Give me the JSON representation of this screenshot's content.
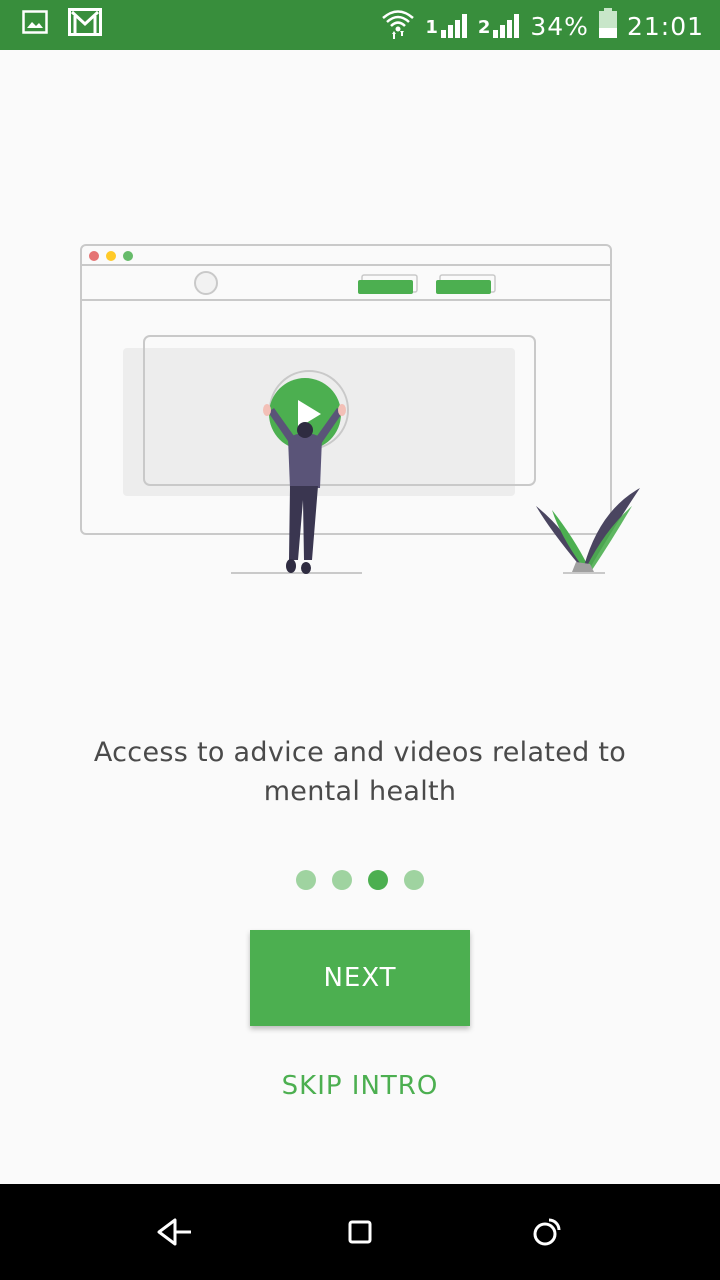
{
  "status_bar": {
    "signal_1": "1",
    "signal_2": "2",
    "battery": "34%",
    "time": "21:01",
    "icons": [
      "image-icon",
      "gmail-icon",
      "wifi-icon",
      "signal-icon",
      "battery-icon"
    ]
  },
  "onboarding": {
    "headline": "Access to advice and videos related to mental health",
    "page_indicator": {
      "total": 4,
      "current": 3
    },
    "next_label": "NEXT",
    "skip_label": "SKIP INTRO"
  },
  "colors": {
    "accent": "#4caf50",
    "status_bar": "#388e3c",
    "dot_inactive": "#9fd3a0",
    "text": "#4a4a4a"
  },
  "nav_bar": {
    "icons": [
      "back-icon",
      "recents-icon",
      "home-icon"
    ]
  }
}
